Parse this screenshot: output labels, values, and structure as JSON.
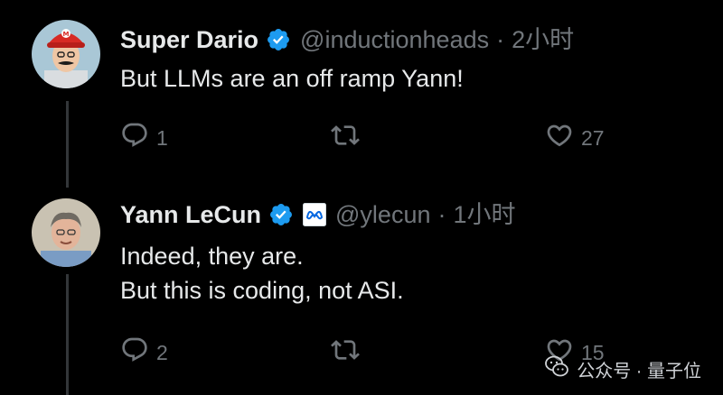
{
  "tweets": [
    {
      "name": "Super Dario",
      "handle": "@inductionheads",
      "separator": "·",
      "time": "2小时",
      "lines": [
        "But LLMs are an off ramp Yann!"
      ],
      "replies": "1",
      "retweets": "",
      "likes": "27"
    },
    {
      "name": "Yann LeCun",
      "handle": "@ylecun",
      "separator": "·",
      "time": "1小时",
      "lines": [
        "Indeed, they are.",
        "But this is coding, not ASI."
      ],
      "replies": "2",
      "retweets": "",
      "likes": "15"
    }
  ],
  "icons": {
    "verified": "verified-badge-icon",
    "affiliation": "meta-logo-icon",
    "reply": "reply-icon",
    "retweet": "retweet-icon",
    "like": "heart-icon"
  },
  "watermark": {
    "label": "公众号 · 量子位"
  },
  "colors": {
    "background": "#000000",
    "text": "#e7e9ea",
    "secondary": "#71767b",
    "verified": "#1d9bf0",
    "thread_line": "#333639"
  }
}
